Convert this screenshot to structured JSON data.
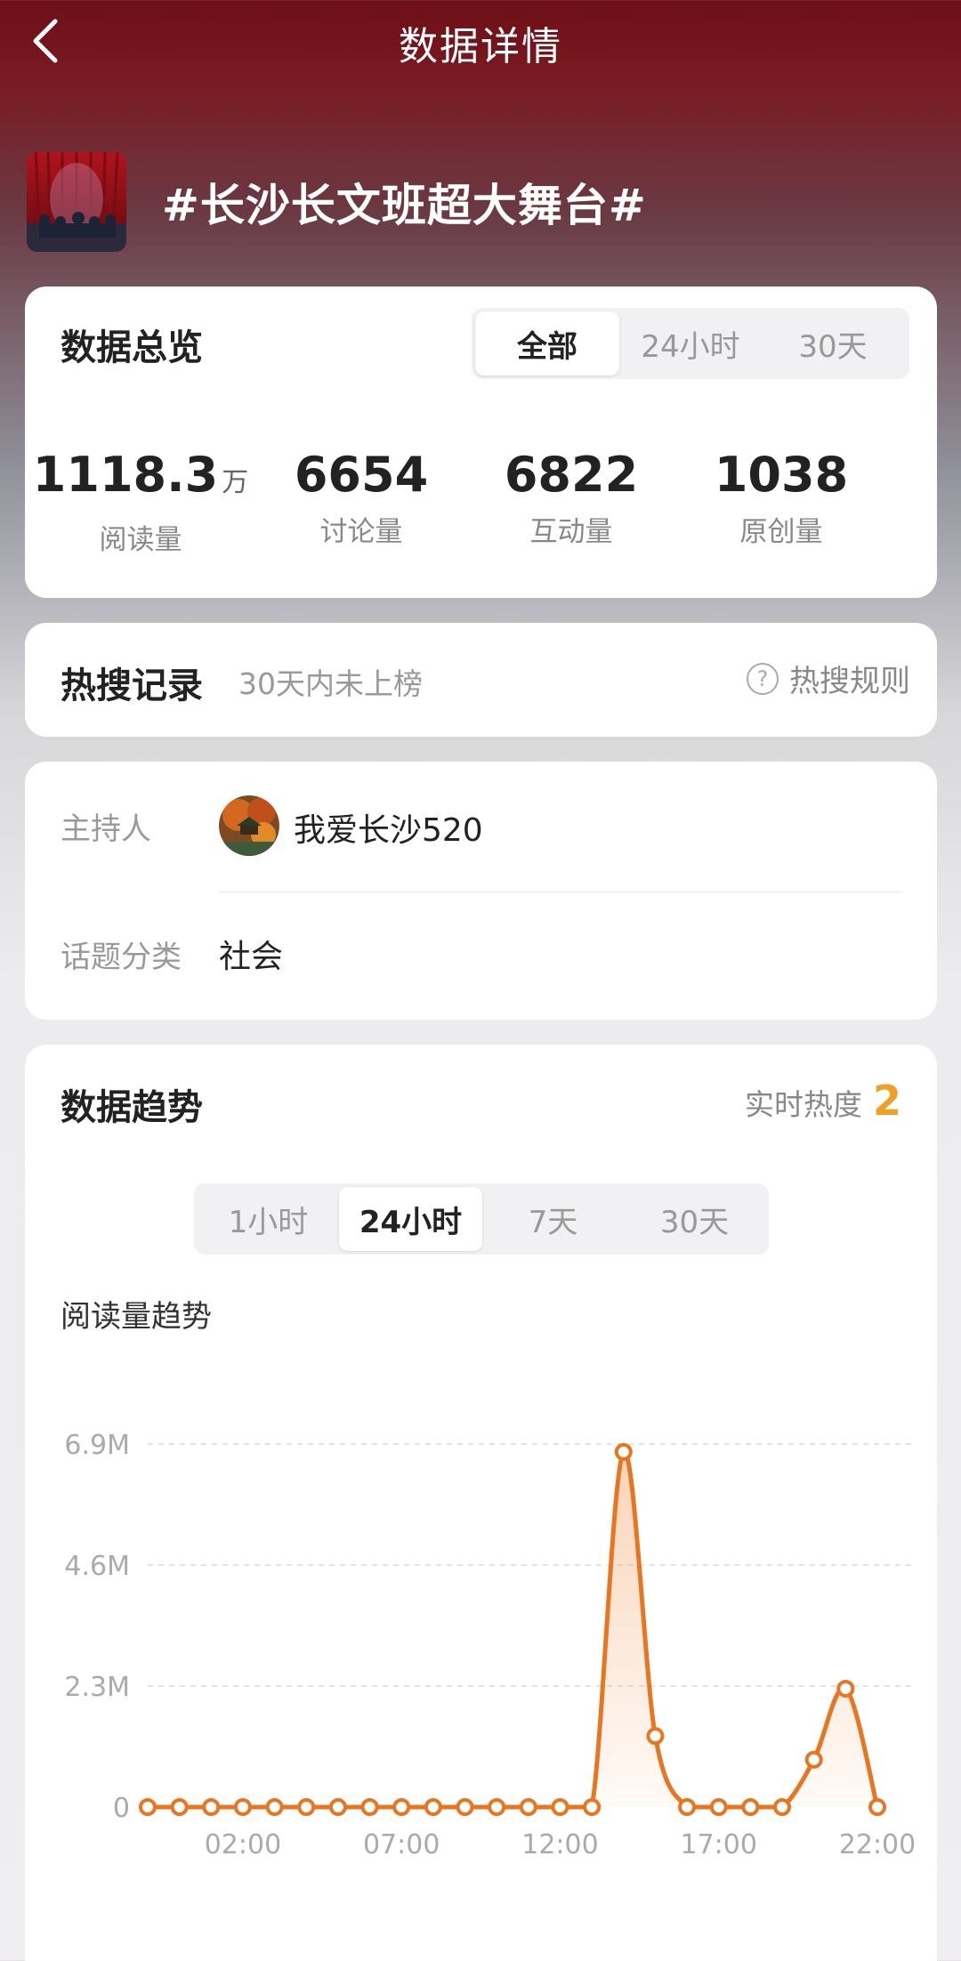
{
  "header": {
    "title": "数据详情",
    "back_icon": "chevron-left-icon"
  },
  "topic": {
    "title": "#长沙长文班超大舞台#"
  },
  "overview": {
    "title": "数据总览",
    "tabs": [
      "全部",
      "24小时",
      "30天"
    ],
    "active_tab": "全部",
    "stats": [
      {
        "value": "1118.3",
        "unit": "万",
        "label": "阅读量"
      },
      {
        "value": "6654",
        "unit": "",
        "label": "讨论量"
      },
      {
        "value": "6822",
        "unit": "",
        "label": "互动量"
      },
      {
        "value": "1038",
        "unit": "",
        "label": "原创量"
      }
    ]
  },
  "hot_search": {
    "title": "热搜记录",
    "subtitle": "30天内未上榜",
    "rule_label": "热搜规则",
    "rule_icon": "question-circle-icon"
  },
  "info": {
    "host_label": "主持人",
    "host_name": "我爱长沙520",
    "category_label": "话题分类",
    "category_value": "社会"
  },
  "trend": {
    "title": "数据趋势",
    "heat_label": "实时热度",
    "heat_value": "2",
    "tabs": [
      "1小时",
      "24小时",
      "7天",
      "30天"
    ],
    "active_tab": "24小时",
    "chart_title": "阅读量趋势"
  },
  "colors": {
    "accent_orange": "#e8751f",
    "heat_orange": "#f0a024",
    "header_red": "#6d0f18"
  },
  "chart_data": {
    "type": "area",
    "title": "阅读量趋势",
    "y_ticks": [
      "0",
      "2.3M",
      "4.6M",
      "6.9M"
    ],
    "ylim": [
      0,
      6.9
    ],
    "y_unit": "M",
    "x_ticks": [
      "02:00",
      "07:00",
      "12:00",
      "17:00",
      "22:00"
    ],
    "x": [
      "23:00",
      "00:00",
      "01:00",
      "02:00",
      "03:00",
      "04:00",
      "05:00",
      "06:00",
      "07:00",
      "08:00",
      "09:00",
      "10:00",
      "11:00",
      "12:00",
      "13:00",
      "14:00",
      "15:00",
      "16:00",
      "17:00",
      "18:00",
      "19:00",
      "20:00",
      "21:00",
      "22:00"
    ],
    "series": [
      {
        "values": [
          0,
          0,
          0,
          0,
          0,
          0,
          0,
          0,
          0,
          0,
          0,
          0,
          0,
          0,
          0,
          6.75,
          1.35,
          0,
          0,
          0,
          0,
          0.9,
          2.25,
          0
        ]
      }
    ],
    "grid": true
  }
}
